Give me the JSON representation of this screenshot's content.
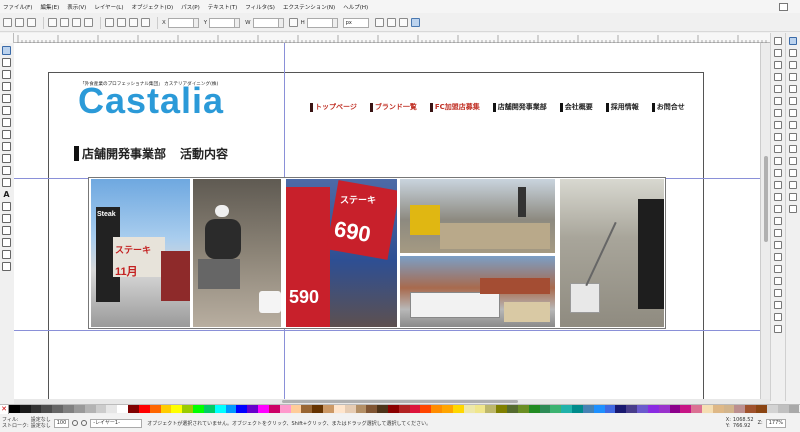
{
  "menubar": {
    "items": [
      "ファイル(F)",
      "編集(E)",
      "表示(V)",
      "レイヤー(L)",
      "オブジェクト(O)",
      "パス(P)",
      "テキスト(T)",
      "フィルタ(S)",
      "エクステンション(N)",
      "ヘルプ(H)"
    ]
  },
  "tool_controls": {
    "x_label": "X",
    "x_value": "",
    "y_label": "Y",
    "y_value": "",
    "w_label": "W",
    "w_value": "",
    "h_label": "H",
    "h_value": "",
    "unit": "px"
  },
  "document": {
    "tagline": "「外食産業のプロフェッショナル集団」 カステリアダイニング(株)",
    "logo": "Castalia",
    "nav": [
      {
        "label": "トップページ",
        "style": "red"
      },
      {
        "label": "ブランド一覧",
        "style": "red"
      },
      {
        "label": "FC加盟店募集",
        "style": "red"
      },
      {
        "label": "店舗開発事業部",
        "style": "dark"
      },
      {
        "label": "会社概要",
        "style": "dark"
      },
      {
        "label": "採用情報",
        "style": "dark"
      },
      {
        "label": "お問合せ",
        "style": "dark"
      }
    ],
    "heading_main": "店舗開発事業部",
    "heading_sub": "活動内容",
    "photos": {
      "p1_sign_top": "Steak",
      "p1_sign_mid": "ステーキ",
      "p1_sign_bottom": "11月",
      "p3_sign_top": "ステーキ",
      "p3_sign_price": "690",
      "p3_sign_price2": "590"
    }
  },
  "statusbar": {
    "fill_label": "フィル:",
    "stroke_label": "ストローク:",
    "fill_value": "設定なし",
    "stroke_value": "設定なし",
    "opacity": "100",
    "layer": "-レイヤー1-",
    "message": "オブジェクトが選択されていません。オブジェクトをクリック、Shift+クリック、またはドラッグ選択して選択してください。",
    "x_label": "X:",
    "y_label": "Y:",
    "x_value": "1068.52",
    "y_value": "766.92",
    "zoom_label": "Z:",
    "zoom_value": "177%"
  },
  "colors": {
    "logo": "#2b9ad8",
    "nav_red": "#c03025",
    "palette": [
      "#000000",
      "#1a1a1a",
      "#333333",
      "#4d4d4d",
      "#666666",
      "#808080",
      "#999999",
      "#b3b3b3",
      "#cccccc",
      "#e6e6e6",
      "#ffffff",
      "#800000",
      "#ff0000",
      "#ff6600",
      "#ffcc00",
      "#ffff00",
      "#99cc00",
      "#00ff00",
      "#00cc66",
      "#00ffff",
      "#0099ff",
      "#0000ff",
      "#6600cc",
      "#ff00ff",
      "#cc0066",
      "#ff99cc",
      "#ffcc99",
      "#996633",
      "#663300",
      "#cc9966",
      "#ffe5cc",
      "#e6ccb3",
      "#b38f66",
      "#805533",
      "#4d3319",
      "#8b0000",
      "#b22222",
      "#dc143c",
      "#ff4500",
      "#ff8c00",
      "#ffa500",
      "#ffd700",
      "#eee8aa",
      "#f0e68c",
      "#bdb76b",
      "#808000",
      "#556b2f",
      "#6b8e23",
      "#228b22",
      "#2e8b57",
      "#3cb371",
      "#20b2aa",
      "#008b8b",
      "#4682b4",
      "#1e90ff",
      "#4169e1",
      "#191970",
      "#483d8b",
      "#6a5acd",
      "#8a2be2",
      "#9932cc",
      "#8b008b",
      "#c71585",
      "#db7093",
      "#f5deb3",
      "#deb887",
      "#d2b48c",
      "#bc8f8f",
      "#a0522d",
      "#8b4513",
      "#d3d3d3",
      "#c0c0c0",
      "#a9a9a9"
    ]
  }
}
